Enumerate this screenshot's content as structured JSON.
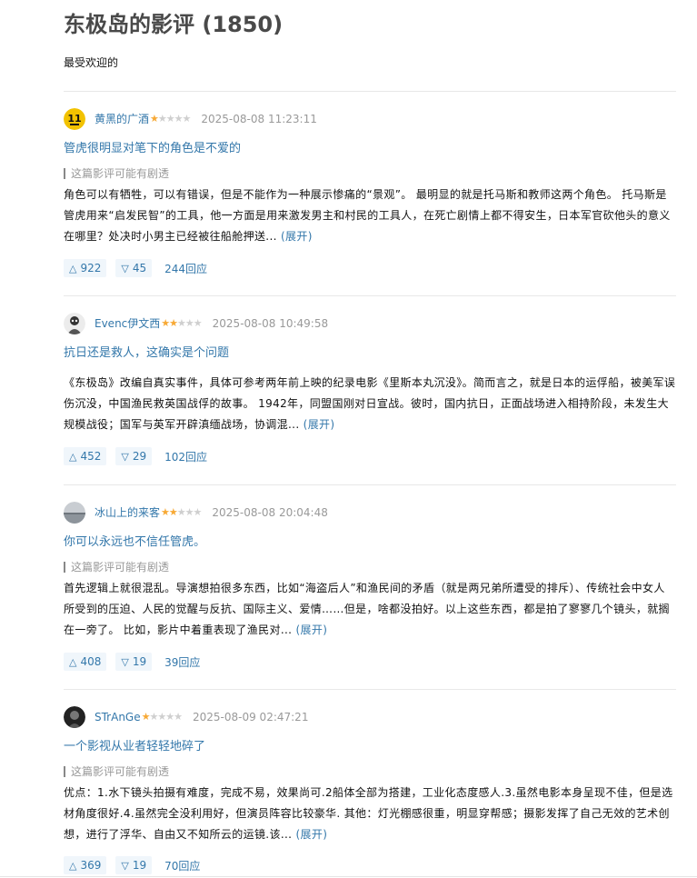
{
  "page": {
    "title": "东极岛的影评 (1850)",
    "sort_label": "最受欢迎的"
  },
  "reviews": [
    {
      "author": "黄黑的广酒",
      "rating": 1,
      "date": "2025-08-08 11:23:11",
      "title": "管虎很明显对笔下的角色是不爱的",
      "spoiler": "这篇影评可能有剧透",
      "body": "角色可以有牺牲，可以有错误，但是不能作为一种展示惨痛的“景观”。 最明显的就是托马斯和教师这两个角色。 托马斯是管虎用来“启发民智”的工具，他一方面是用来激发男主和村民的工具人，在死亡剧情上都不得安生，日本军官砍他头的意义在哪里？处决时小男主已经被往船舱押送...",
      "expand": "(展开)",
      "up": "922",
      "down": "45",
      "replies": "244回应",
      "avatar_icon": "badge-11-avatar"
    },
    {
      "author": "Evenc伊文西",
      "rating": 2,
      "date": "2025-08-08 10:49:58",
      "title": "抗日还是救人，这确实是个问题",
      "spoiler": "",
      "body": "《东极岛》改编自真实事件，具体可参考两年前上映的纪录电影《里斯本丸沉没》。简而言之，就是日本的运俘船，被美军误伤沉没，中国渔民救英国战俘的故事。 1942年，同盟国刚对日宣战。彼时，国内抗日，正面战场进入相持阶段，未发生大规模战役；国军与英军开辟滇缅战场，协调混...",
      "expand": "(展开)",
      "up": "452",
      "down": "29",
      "replies": "102回应",
      "avatar_icon": "cartoon-avatar"
    },
    {
      "author": "冰山上的来客",
      "rating": 2,
      "date": "2025-08-08 20:04:48",
      "title": "你可以永远也不信任管虎。",
      "spoiler": "这篇影评可能有剧透",
      "body": "首先逻辑上就很混乱。导演想拍很多东西，比如“海盗后人”和渔民间的矛盾（就是两兄弟所遭受的排斥）、传统社会中女人所受到的压迫、人民的觉醒与反抗、国际主义、爱情……但是，啥都没拍好。以上这些东西，都是拍了寥寥几个镜头，就搁在一旁了。 比如，影片中着重表现了渔民对...",
      "expand": "(展开)",
      "up": "408",
      "down": "19",
      "replies": "39回应",
      "avatar_icon": "landscape-avatar"
    },
    {
      "author": "STrAnGe",
      "rating": 1,
      "date": "2025-08-09 02:47:21",
      "title": "一个影视从业者轻轻地碎了",
      "spoiler": "这篇影评可能有剧透",
      "body": "优点：1.水下镜头拍摄有难度，完成不易，效果尚可.2船体全部为搭建，工业化态度感人.3.虽然电影本身呈现不佳，但是选材角度很好.4.虽然完全没利用好，但演员阵容比较豪华. 其他：灯光棚感很重，明显穿帮感；摄影发挥了自己无效的艺术创想，进行了浮华、自由又不知所云的运镜.该...",
      "expand": "(展开)",
      "up": "369",
      "down": "19",
      "replies": "70回应",
      "avatar_icon": "dark-portrait-avatar"
    }
  ],
  "colors": {
    "link": "#3377aa",
    "star_on": "#f7a935",
    "star_off": "#cfcfcf",
    "muted": "#999999",
    "vote_bg": "#f0f6fb"
  }
}
